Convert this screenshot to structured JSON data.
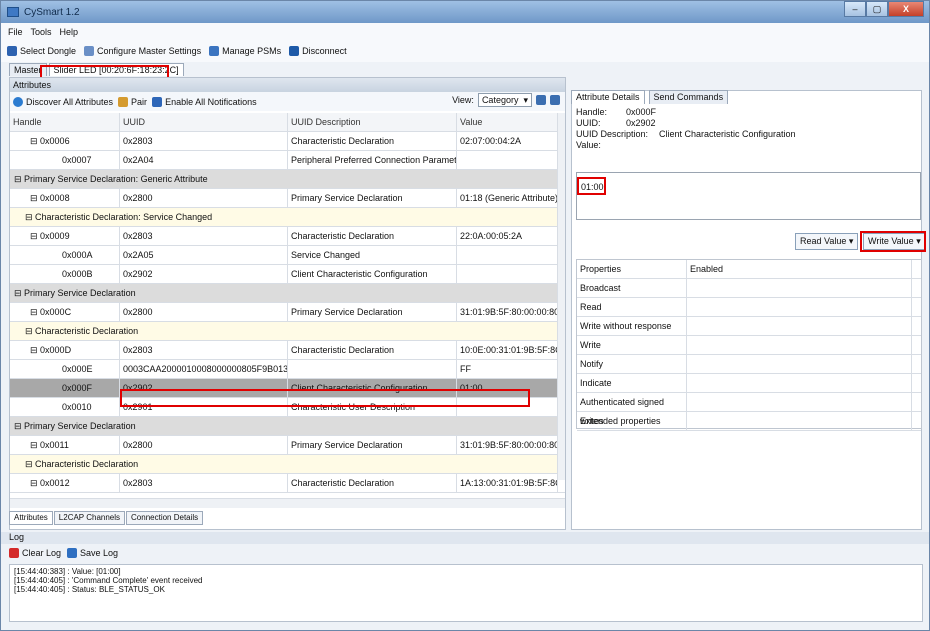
{
  "window": {
    "title": "CySmart 1.2",
    "controls": [
      "–",
      "▢",
      "X"
    ]
  },
  "menu": [
    "File",
    "Tools",
    "Help"
  ],
  "toolbar": {
    "select": "Select Dongle",
    "config": "Configure Master Settings",
    "psms": "Manage PSMs",
    "disconnect": "Disconnect"
  },
  "top_tabs": {
    "master": "Master",
    "device": "Slider LED [00:20:6F:18:23:2C]"
  },
  "attributes": {
    "title": "Attributes",
    "discover": "Discover All Attributes",
    "pair": "Pair",
    "notify": "Enable All Notifications",
    "view_label": "View:",
    "view_value": "Category"
  },
  "columns": [
    "Handle",
    "UUID",
    "UUID Description",
    "Value"
  ],
  "rows": [
    {
      "type": "normal",
      "handle": "⊟ 0x0006",
      "uuid": "0x2803",
      "desc": "Characteristic Declaration",
      "value": "02:07:00:04:2A"
    },
    {
      "type": "normal",
      "handle": "0x0007",
      "uuid": "0x2A04",
      "desc": "Peripheral Preferred Connection Parameters",
      "value": ""
    },
    {
      "type": "section",
      "label": "⊟ Primary Service Declaration: Generic Attribute"
    },
    {
      "type": "normal",
      "handle": "⊟ 0x0008",
      "uuid": "0x2800",
      "desc": "Primary Service Declaration",
      "value": "01:18 (Generic Attribute)"
    },
    {
      "type": "char",
      "label": "⊟ Characteristic Declaration: Service Changed"
    },
    {
      "type": "normal",
      "handle": "⊟ 0x0009",
      "uuid": "0x2803",
      "desc": "Characteristic Declaration",
      "value": "22:0A:00:05:2A"
    },
    {
      "type": "normal",
      "handle": "0x000A",
      "uuid": "0x2A05",
      "desc": "Service Changed",
      "value": ""
    },
    {
      "type": "normal",
      "handle": "0x000B",
      "uuid": "0x2902",
      "desc": "Client Characteristic Configuration",
      "value": ""
    },
    {
      "type": "section",
      "label": "⊟ Primary Service Declaration"
    },
    {
      "type": "normal",
      "handle": "⊟ 0x000C",
      "uuid": "0x2800",
      "desc": "Primary Service Declaration",
      "value": "31:01:9B:5F:80:00:00:80"
    },
    {
      "type": "char",
      "label": "⊟ Characteristic Declaration"
    },
    {
      "type": "normal",
      "handle": "⊟ 0x000D",
      "uuid": "0x2803",
      "desc": "Characteristic Declaration",
      "value": "10:0E:00:31:01:9B:5F:8C"
    },
    {
      "type": "normal",
      "handle": "0x000E",
      "uuid": "0003CAA2000010008000000805F9B0131",
      "desc": "",
      "value": "FF"
    },
    {
      "type": "sel",
      "handle": "0x000F",
      "uuid": "0x2902",
      "desc": "Client Characteristic Configuration",
      "value": "01:00"
    },
    {
      "type": "normal",
      "handle": "0x0010",
      "uuid": "0x2901",
      "desc": "Characteristic User Description",
      "value": ""
    },
    {
      "type": "section",
      "label": "⊟ Primary Service Declaration"
    },
    {
      "type": "normal",
      "handle": "⊟ 0x0011",
      "uuid": "0x2800",
      "desc": "Primary Service Declaration",
      "value": "31:01:9B:5F:80:00:00:80"
    },
    {
      "type": "char",
      "label": "⊟ Characteristic Declaration"
    },
    {
      "type": "normal",
      "handle": "⊟ 0x0012",
      "uuid": "0x2803",
      "desc": "Characteristic Declaration",
      "value": "1A:13:00:31:01:9B:5F:8C"
    }
  ],
  "bottom_tabs": [
    "Attributes",
    "L2CAP Channels",
    "Connection Details"
  ],
  "right": {
    "tabs": [
      "Attribute Details",
      "Send Commands"
    ],
    "handle_label": "Handle:",
    "handle": "0x000F",
    "uuid_label": "UUID:",
    "uuid": "0x2902",
    "desc_label": "UUID Description:",
    "desc": "Client Characteristic Configuration",
    "value_label": "Value:",
    "value": "01:00",
    "read": "Read Value",
    "write": "Write Value",
    "props_header": [
      "Properties",
      "Enabled"
    ],
    "props": [
      "Broadcast",
      "Read",
      "Write without response",
      "Write",
      "Notify",
      "Indicate",
      "Authenticated signed writes",
      "Extended properties"
    ]
  },
  "log": {
    "title": "Log",
    "clear": "Clear Log",
    "save": "Save Log",
    "lines": [
      "[15:44:40:383] :     Value: [01:00]",
      "[15:44:40:405] : 'Command Complete' event received",
      "[15:44:40:405] :     Status: BLE_STATUS_OK"
    ]
  },
  "colors": {
    "highlight": "#e00000",
    "selected": "#a8a8a8"
  }
}
